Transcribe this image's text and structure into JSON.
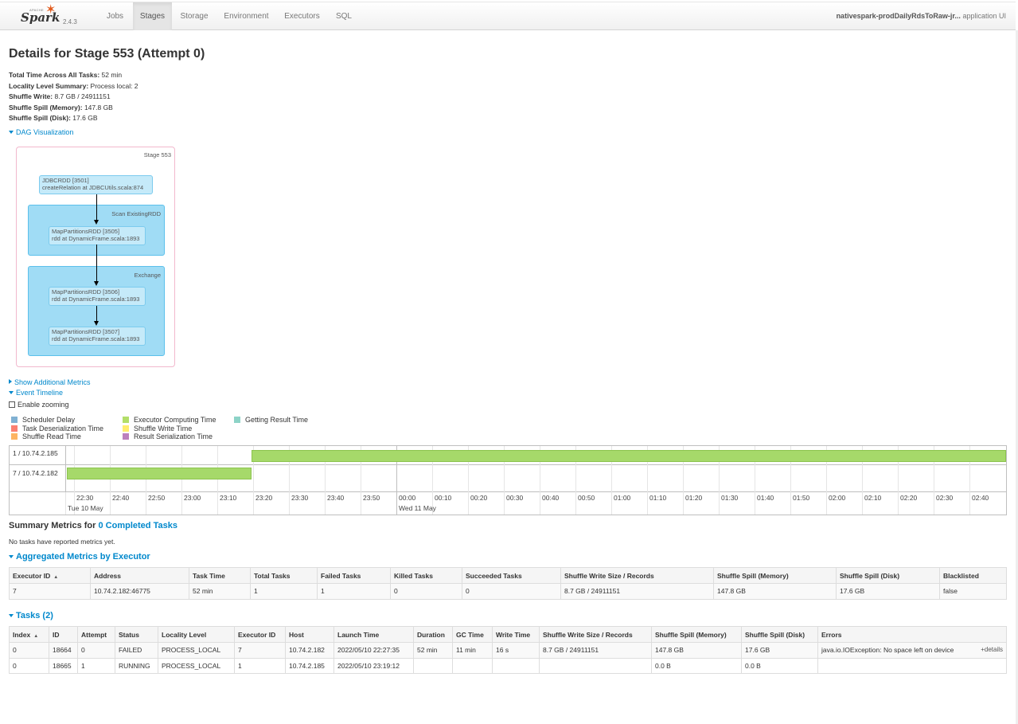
{
  "nav": {
    "brand": "Spark",
    "brand_apache": "APACHE",
    "version": "2.4.3",
    "tabs": [
      "Jobs",
      "Stages",
      "Storage",
      "Environment",
      "Executors",
      "SQL"
    ],
    "active_tab": "Stages",
    "app_name": "nativespark-prodDailyRdsToRaw-jr...",
    "app_suffix": "application UI"
  },
  "page": {
    "title": "Details for Stage 553 (Attempt 0)",
    "summary": [
      {
        "label": "Total Time Across All Tasks:",
        "value": "52 min"
      },
      {
        "label": "Locality Level Summary:",
        "value": "Process local: 2"
      },
      {
        "label": "Shuffle Write:",
        "value": "8.7 GB / 24911151"
      },
      {
        "label": "Shuffle Spill (Memory):",
        "value": "147.8 GB"
      },
      {
        "label": "Shuffle Spill (Disk):",
        "value": "17.6 GB"
      }
    ],
    "dag_toggle": "DAG Visualization",
    "additional_metrics_toggle": "Show Additional Metrics",
    "event_timeline_toggle": "Event Timeline",
    "enable_zooming": "Enable zooming"
  },
  "dag": {
    "stage_label": "Stage 553",
    "rdd1": {
      "line1": "JDBCRDD [3501]",
      "line2": "createRelation at JDBCUtils.scala:874"
    },
    "cluster1": "Scan ExistingRDD",
    "rdd2": {
      "line1": "MapPartitionsRDD [3505]",
      "line2": "rdd at DynamicFrame.scala:1893"
    },
    "cluster2": "Exchange",
    "rdd3": {
      "line1": "MapPartitionsRDD [3506]",
      "line2": "rdd at DynamicFrame.scala:1893"
    },
    "rdd4": {
      "line1": "MapPartitionsRDD [3507]",
      "line2": "rdd at DynamicFrame.scala:1893"
    }
  },
  "legend": [
    {
      "label": "Scheduler Delay",
      "color": "#80b1d3"
    },
    {
      "label": "Task Deserialization Time",
      "color": "#fb8072"
    },
    {
      "label": "Shuffle Read Time",
      "color": "#fdb462"
    },
    {
      "label": "Executor Computing Time",
      "color": "#b3de69"
    },
    {
      "label": "Shuffle Write Time",
      "color": "#ffed6f"
    },
    {
      "label": "Result Serialization Time",
      "color": "#bc80bd"
    },
    {
      "label": "Getting Result Time",
      "color": "#8dd3c7"
    }
  ],
  "timeline": {
    "rows": [
      "1 / 10.74.2.185",
      "7 / 10.74.2.182"
    ],
    "ticks": [
      "22:30",
      "22:40",
      "22:50",
      "23:00",
      "23:10",
      "23:20",
      "23:30",
      "23:40",
      "23:50",
      "00:00",
      "00:10",
      "00:20",
      "00:30",
      "00:40",
      "00:50",
      "01:00",
      "01:10",
      "01:20",
      "01:30",
      "01:40",
      "01:50",
      "02:00",
      "02:10",
      "02:20",
      "02:30",
      "02:40"
    ],
    "date1": "Tue 10 May",
    "date2": "Wed 11 May",
    "tasks": [
      {
        "row": "1 / 10.74.2.185",
        "start": "2022/05/10 23:19:12",
        "end": "running"
      },
      {
        "row": "7 / 10.74.2.182",
        "start": "2022/05/10 22:27:35",
        "end": "2022/05/10 23:19:35"
      }
    ]
  },
  "summary_metrics": {
    "prefix": "Summary Metrics for",
    "link": "0 Completed Tasks",
    "empty": "No tasks have reported metrics yet."
  },
  "executors": {
    "title": "Aggregated Metrics by Executor",
    "headers": [
      "Executor ID",
      "Address",
      "Task Time",
      "Total Tasks",
      "Failed Tasks",
      "Killed Tasks",
      "Succeeded Tasks",
      "Shuffle Write Size / Records",
      "Shuffle Spill (Memory)",
      "Shuffle Spill (Disk)",
      "Blacklisted"
    ],
    "rows": [
      [
        "7",
        "10.74.2.182:46775",
        "52 min",
        "1",
        "1",
        "0",
        "0",
        "8.7 GB / 24911151",
        "147.8 GB",
        "17.6 GB",
        "false"
      ]
    ]
  },
  "tasks": {
    "title": "Tasks (2)",
    "headers": [
      "Index",
      "ID",
      "Attempt",
      "Status",
      "Locality Level",
      "Executor ID",
      "Host",
      "Launch Time",
      "Duration",
      "GC Time",
      "Write Time",
      "Shuffle Write Size / Records",
      "Shuffle Spill (Memory)",
      "Shuffle Spill (Disk)",
      "Errors"
    ],
    "rows": [
      [
        "0",
        "18664",
        "0",
        "FAILED",
        "PROCESS_LOCAL",
        "7",
        "10.74.2.182",
        "2022/05/10 22:27:35",
        "52 min",
        "11 min",
        "16 s",
        "8.7 GB / 24911151",
        "147.8 GB",
        "17.6 GB",
        "java.io.IOException: No space left on device"
      ],
      [
        "0",
        "18665",
        "1",
        "RUNNING",
        "PROCESS_LOCAL",
        "1",
        "10.74.2.185",
        "2022/05/10 23:19:12",
        "",
        "",
        "",
        "",
        "0.0 B",
        "0.0 B",
        ""
      ]
    ],
    "details_link": "+details"
  }
}
